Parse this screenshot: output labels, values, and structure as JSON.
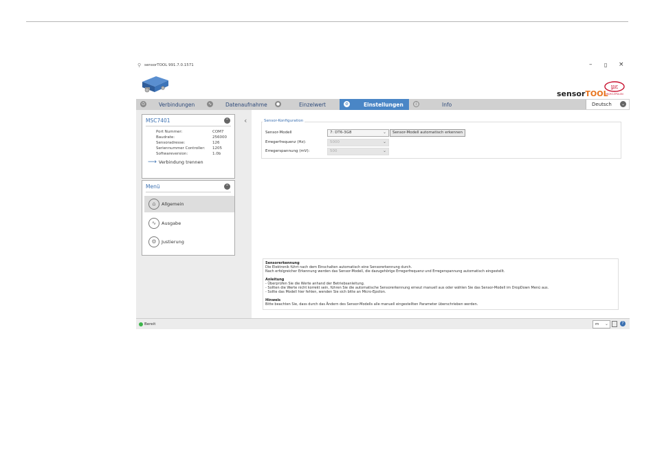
{
  "window": {
    "title": "sensorTOOL 991.7.0.1571",
    "controls": {
      "minimize": "–",
      "maximize": "▯",
      "close": "×"
    }
  },
  "branding": {
    "sensor": "sensor",
    "tool": "TOOL",
    "micro_epsilon": "MICRO-EPSILON",
    "accent_color": "#e8731c",
    "logo_color": "#c8102e"
  },
  "tabs": [
    {
      "label": "Verbindungen",
      "icon": "plug-icon"
    },
    {
      "label": "Datenaufnahme",
      "icon": "record-icon"
    },
    {
      "label": "Einzelwert",
      "icon": "value-icon"
    },
    {
      "label": "Einstellungen",
      "icon": "gear-icon",
      "active": true
    },
    {
      "label": "Info",
      "icon": "info-icon"
    }
  ],
  "language": {
    "value": "Deutsch"
  },
  "device_panel": {
    "title": "MSC7401",
    "rows": [
      {
        "label": "Port Nummer:",
        "value": "COM7"
      },
      {
        "label": "Baudrate:",
        "value": "256000"
      },
      {
        "label": "Sensoradresse:",
        "value": "126"
      },
      {
        "label": "Seriennummer Controller:",
        "value": "1205"
      },
      {
        "label": "Softwareversion:",
        "value": "1.0b"
      }
    ],
    "disconnect": "Verbindung trennen"
  },
  "menu": {
    "title": "Menü",
    "items": [
      {
        "label": "Allgemein",
        "icon": "home-icon",
        "selected": true
      },
      {
        "label": "Ausgabe",
        "icon": "wave-icon"
      },
      {
        "label": "Justierung",
        "icon": "settings-icon"
      }
    ]
  },
  "sensor_config": {
    "legend": "Sensor-Konfiguration",
    "model_label": "Sensor-Modell",
    "model_value": "7: DT6-3G8",
    "auto_detect_button": "Sensor-Modell automatisch erkennen",
    "frequency_label": "Erregerfrequenz (Hz):",
    "frequency_value": "5000",
    "voltage_label": "Erregerspannung (mV):",
    "voltage_value": "500"
  },
  "hints": [
    {
      "title": "Sensorerkennung",
      "lines": [
        "Die Elektronik führt nach dem Einschalten automatisch eine Sensorerkennung durch.",
        "Nach erfolgreicher Erkennung werden das Sensor-Modell, die dazugehörige Erregerfrequenz und Erregerspannung automatisch eingestellt."
      ]
    },
    {
      "title": "Anleitung",
      "lines": [
        "- Überprüfen Sie die Werte anhand der Betriebsanleitung.",
        "- Sollten die Werte nicht korrekt sein, führen Sie die automatische Sensorerkennung erneut manuell aus oder wählen Sie das Sensor-Modell im DropDown Menü aus.",
        "- Sollte das Modell hier fehlen, wenden Sie sich bitte an Micro-Epsilon."
      ]
    },
    {
      "title": "Hinweis",
      "lines": [
        "Bitte beachten Sie, dass durch das Ändern des Sensor-Modells alle manuell eingestellten Parameter überschrieben werden."
      ]
    }
  ],
  "status": {
    "text": "Bereit",
    "unit": "m",
    "status_color": "#3cb44b"
  }
}
